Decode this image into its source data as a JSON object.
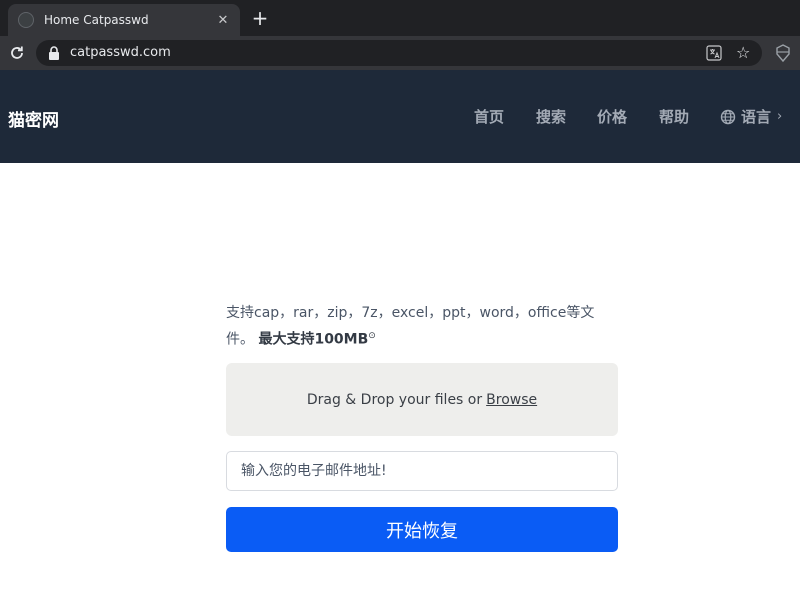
{
  "browser": {
    "tab_title": "Home Catpasswd",
    "tab_close": "✕",
    "new_tab": "+",
    "url": "catpasswd.com"
  },
  "header": {
    "brand": "猫密网",
    "nav": [
      {
        "label": "首页"
      },
      {
        "label": "搜索"
      },
      {
        "label": "价格"
      },
      {
        "label": "帮助"
      }
    ],
    "language_label": "语言",
    "language_chevron": "›"
  },
  "upload": {
    "info_text": "支持cap，rar，zip，7z，excel，ppt，word，office等文件。",
    "info_strong": "最大支持100MB",
    "info_sup": "⊙",
    "drop_text": "Drag & Drop your files or",
    "browse_label": "Browse",
    "email_placeholder": "输入您的电子邮件地址!",
    "submit_label": "开始恢复"
  },
  "colors": {
    "header_bg": "#1e2939",
    "accent": "#0a5cf5",
    "dropzone_bg": "#eeeeec"
  }
}
